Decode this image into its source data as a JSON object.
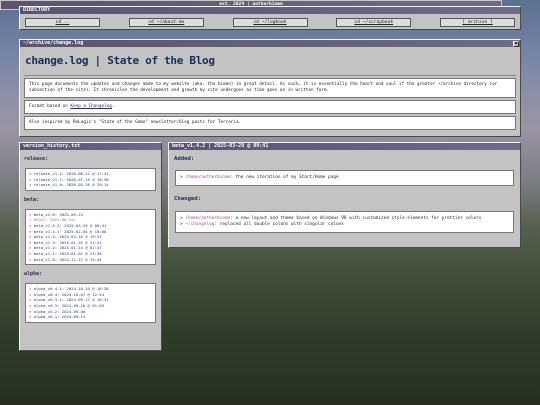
{
  "directory": {
    "title": "DIRECTORY",
    "links": [
      "cd ..",
      "cd ~/about-me",
      "cd ~/logbook",
      "cd ~/scrapbook",
      "[ archive ]"
    ]
  },
  "changelog_window": {
    "title": "~/archive/change.log",
    "close_glyph": "×",
    "heading": "change.log | State of the Blog",
    "intro": "This page documents the updates and changes made to my website (aka. the biome) in great detail. As such, it is essentially the heart and soul if the greater ~/archive directory (or subsection of the site). It chronicles the development and growth my site undergoes as time goes on in written form.",
    "format_prefix": "Format based on ",
    "format_link": "Keep a Changelog",
    "format_suffix": ".",
    "inspired": "Also inspired by ReLogic's \"State of the Game\" newsletter/blog posts for Terraria."
  },
  "version_history": {
    "title": "version_history.txt",
    "sections": [
      {
        "label": "release:",
        "items": [
          "> release_v1.2: 2026-08-12 @ 17:41",
          "> release_v1.1: 2026-07-15 @ 18:58",
          "> release_v1.0: 2026-05-26 @ 20:14"
        ]
      },
      {
        "label": "beta:",
        "items": [
          "> beta_v2.0: 2025-09-24",
          "> RESET: 2025-06-tel",
          "> beta_v1.4.2: 2025-03-29 @ 09:41",
          "> beta_v1.4.1: 2025-02-04 @ 10:06",
          "> beta_v1.4: 2025-02-16 @ 19:53",
          "> beta_v1.3: 2025-01-25 @ 21:21",
          "> beta_v1.2: 2025-01-14 @ 02:47",
          "> beta_v1.1: 2025-01-01 @ 21:38",
          "> beta_v1.0: 2024-12-22 @ 15:44"
        ]
      },
      {
        "label": "alpha:",
        "items": [
          "> alpha_v0.4.1: 2024-10-10 @ 16:38",
          "> alpha_v0.4: 2024-10-07 @ 12:54",
          "> alpha_v0.3.1: 2024-09-17 @ 10:31",
          "> alpha_v0.3: 2024-09-16 @ 01:03",
          "> alpha_v0.2: 2024-09-dd",
          "> alpha_v0.1: 2024-09-14"
        ]
      }
    ]
  },
  "beta_entry": {
    "title": "beta_v1.4.2 | 2025-03-29 @ 09:41",
    "added_label": "Added:",
    "added_items": [
      {
        "path": "/home/aetherbiome",
        "text": ": the new iteration of my Start/Home page"
      }
    ],
    "changed_label": "Changed:",
    "changed_items": [
      {
        "path": "/home/aetherbiome",
        "text": ": a new layout and theme based on Windows 98 with customized style elements for prettier colors"
      },
      {
        "path": "~/changelog",
        "text": ": replaced all double colons with singular colons"
      }
    ]
  },
  "footer": {
    "text": "est. 2024 | aetherbiome"
  }
}
